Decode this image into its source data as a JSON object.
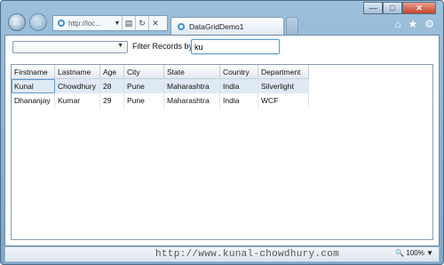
{
  "browser": {
    "address_text": "http://loc...",
    "tab_label": "DataGridDemo1",
    "zoom": "100%"
  },
  "toolbar": {
    "filter_label": "Filter Records by:",
    "filter_value": "ku",
    "combo_value": ""
  },
  "grid": {
    "columns": [
      "Firstname",
      "Lastname",
      "Age",
      "City",
      "State",
      "Country",
      "Department"
    ],
    "rows": [
      [
        "Kunal",
        "Chowdhury",
        "28",
        "Pune",
        "Maharashtra",
        "India",
        "Silverlight"
      ],
      [
        "Dhananjay",
        "Kumar",
        "29",
        "Pune",
        "Maharashtra",
        "India",
        "WCF"
      ]
    ]
  },
  "watermark": "http://www.kunal-chowdhury.com"
}
